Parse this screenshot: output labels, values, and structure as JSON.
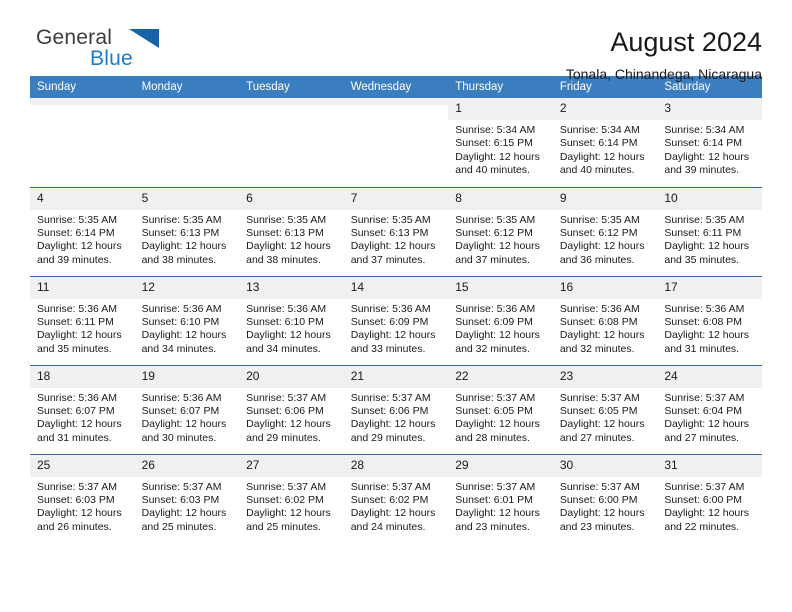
{
  "brand": {
    "name_part1": "General",
    "name_part2": "Blue",
    "flag_icon": "blue-triangle-flag-icon"
  },
  "header": {
    "month_title": "August 2024",
    "location": "Tonala, Chinandega, Nicaragua"
  },
  "colors": {
    "header_row": "#3a7ebf",
    "grid_line": "#2f6da8",
    "daynum_strip": "#f0f0f0",
    "brand_blue": "#1c7ac9",
    "flag_blue": "#1663a8"
  },
  "weekdays": [
    "Sunday",
    "Monday",
    "Tuesday",
    "Wednesday",
    "Thursday",
    "Friday",
    "Saturday"
  ],
  "weeks": [
    [
      {
        "day": "",
        "empty": true
      },
      {
        "day": "",
        "empty": true
      },
      {
        "day": "",
        "empty": true
      },
      {
        "day": "",
        "empty": true
      },
      {
        "day": "1",
        "sunrise": "Sunrise: 5:34 AM",
        "sunset": "Sunset: 6:15 PM",
        "daylight": "Daylight: 12 hours and 40 minutes."
      },
      {
        "day": "2",
        "sunrise": "Sunrise: 5:34 AM",
        "sunset": "Sunset: 6:14 PM",
        "daylight": "Daylight: 12 hours and 40 minutes."
      },
      {
        "day": "3",
        "sunrise": "Sunrise: 5:34 AM",
        "sunset": "Sunset: 6:14 PM",
        "daylight": "Daylight: 12 hours and 39 minutes."
      }
    ],
    [
      {
        "day": "4",
        "sunrise": "Sunrise: 5:35 AM",
        "sunset": "Sunset: 6:14 PM",
        "daylight": "Daylight: 12 hours and 39 minutes."
      },
      {
        "day": "5",
        "sunrise": "Sunrise: 5:35 AM",
        "sunset": "Sunset: 6:13 PM",
        "daylight": "Daylight: 12 hours and 38 minutes."
      },
      {
        "day": "6",
        "sunrise": "Sunrise: 5:35 AM",
        "sunset": "Sunset: 6:13 PM",
        "daylight": "Daylight: 12 hours and 38 minutes."
      },
      {
        "day": "7",
        "sunrise": "Sunrise: 5:35 AM",
        "sunset": "Sunset: 6:13 PM",
        "daylight": "Daylight: 12 hours and 37 minutes."
      },
      {
        "day": "8",
        "sunrise": "Sunrise: 5:35 AM",
        "sunset": "Sunset: 6:12 PM",
        "daylight": "Daylight: 12 hours and 37 minutes."
      },
      {
        "day": "9",
        "sunrise": "Sunrise: 5:35 AM",
        "sunset": "Sunset: 6:12 PM",
        "daylight": "Daylight: 12 hours and 36 minutes."
      },
      {
        "day": "10",
        "sunrise": "Sunrise: 5:35 AM",
        "sunset": "Sunset: 6:11 PM",
        "daylight": "Daylight: 12 hours and 35 minutes."
      }
    ],
    [
      {
        "day": "11",
        "sunrise": "Sunrise: 5:36 AM",
        "sunset": "Sunset: 6:11 PM",
        "daylight": "Daylight: 12 hours and 35 minutes."
      },
      {
        "day": "12",
        "sunrise": "Sunrise: 5:36 AM",
        "sunset": "Sunset: 6:10 PM",
        "daylight": "Daylight: 12 hours and 34 minutes."
      },
      {
        "day": "13",
        "sunrise": "Sunrise: 5:36 AM",
        "sunset": "Sunset: 6:10 PM",
        "daylight": "Daylight: 12 hours and 34 minutes."
      },
      {
        "day": "14",
        "sunrise": "Sunrise: 5:36 AM",
        "sunset": "Sunset: 6:09 PM",
        "daylight": "Daylight: 12 hours and 33 minutes."
      },
      {
        "day": "15",
        "sunrise": "Sunrise: 5:36 AM",
        "sunset": "Sunset: 6:09 PM",
        "daylight": "Daylight: 12 hours and 32 minutes."
      },
      {
        "day": "16",
        "sunrise": "Sunrise: 5:36 AM",
        "sunset": "Sunset: 6:08 PM",
        "daylight": "Daylight: 12 hours and 32 minutes."
      },
      {
        "day": "17",
        "sunrise": "Sunrise: 5:36 AM",
        "sunset": "Sunset: 6:08 PM",
        "daylight": "Daylight: 12 hours and 31 minutes."
      }
    ],
    [
      {
        "day": "18",
        "sunrise": "Sunrise: 5:36 AM",
        "sunset": "Sunset: 6:07 PM",
        "daylight": "Daylight: 12 hours and 31 minutes."
      },
      {
        "day": "19",
        "sunrise": "Sunrise: 5:36 AM",
        "sunset": "Sunset: 6:07 PM",
        "daylight": "Daylight: 12 hours and 30 minutes."
      },
      {
        "day": "20",
        "sunrise": "Sunrise: 5:37 AM",
        "sunset": "Sunset: 6:06 PM",
        "daylight": "Daylight: 12 hours and 29 minutes."
      },
      {
        "day": "21",
        "sunrise": "Sunrise: 5:37 AM",
        "sunset": "Sunset: 6:06 PM",
        "daylight": "Daylight: 12 hours and 29 minutes."
      },
      {
        "day": "22",
        "sunrise": "Sunrise: 5:37 AM",
        "sunset": "Sunset: 6:05 PM",
        "daylight": "Daylight: 12 hours and 28 minutes."
      },
      {
        "day": "23",
        "sunrise": "Sunrise: 5:37 AM",
        "sunset": "Sunset: 6:05 PM",
        "daylight": "Daylight: 12 hours and 27 minutes."
      },
      {
        "day": "24",
        "sunrise": "Sunrise: 5:37 AM",
        "sunset": "Sunset: 6:04 PM",
        "daylight": "Daylight: 12 hours and 27 minutes."
      }
    ],
    [
      {
        "day": "25",
        "sunrise": "Sunrise: 5:37 AM",
        "sunset": "Sunset: 6:03 PM",
        "daylight": "Daylight: 12 hours and 26 minutes."
      },
      {
        "day": "26",
        "sunrise": "Sunrise: 5:37 AM",
        "sunset": "Sunset: 6:03 PM",
        "daylight": "Daylight: 12 hours and 25 minutes."
      },
      {
        "day": "27",
        "sunrise": "Sunrise: 5:37 AM",
        "sunset": "Sunset: 6:02 PM",
        "daylight": "Daylight: 12 hours and 25 minutes."
      },
      {
        "day": "28",
        "sunrise": "Sunrise: 5:37 AM",
        "sunset": "Sunset: 6:02 PM",
        "daylight": "Daylight: 12 hours and 24 minutes."
      },
      {
        "day": "29",
        "sunrise": "Sunrise: 5:37 AM",
        "sunset": "Sunset: 6:01 PM",
        "daylight": "Daylight: 12 hours and 23 minutes."
      },
      {
        "day": "30",
        "sunrise": "Sunrise: 5:37 AM",
        "sunset": "Sunset: 6:00 PM",
        "daylight": "Daylight: 12 hours and 23 minutes."
      },
      {
        "day": "31",
        "sunrise": "Sunrise: 5:37 AM",
        "sunset": "Sunset: 6:00 PM",
        "daylight": "Daylight: 12 hours and 22 minutes."
      }
    ]
  ]
}
